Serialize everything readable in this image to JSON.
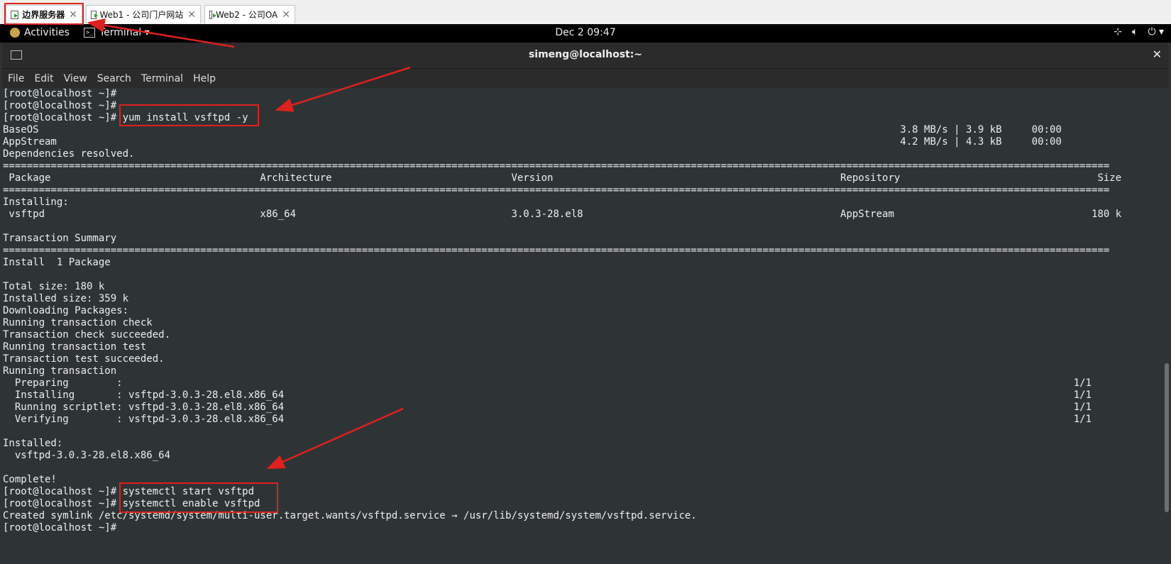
{
  "vm_tabs": [
    {
      "label": "边界服务器",
      "active": true
    },
    {
      "label": "Web1 - 公司门户网站",
      "active": false
    },
    {
      "label": "Web2 - 公司OA",
      "active": false
    }
  ],
  "topbar": {
    "activities": "Activities",
    "app": "Terminal ▾",
    "clock": "Dec 2  09:47",
    "icons": [
      "network-icon",
      "volume-icon",
      "power-icon"
    ]
  },
  "window": {
    "title": "simeng@localhost:~",
    "menu": [
      "File",
      "Edit",
      "View",
      "Search",
      "Terminal",
      "Help"
    ]
  },
  "terminal_lines": [
    "[root@localhost ~]#",
    "[root@localhost ~]#",
    "[root@localhost ~]# yum install vsftpd -y",
    "BaseOS                                                                                                                                                3.8 MB/s | 3.9 kB     00:00",
    "AppStream                                                                                                                                             4.2 MB/s | 4.3 kB     00:00",
    "Dependencies resolved.",
    "=========================================================================================================================================================================================",
    " Package                                   Architecture                              Version                                                Repository                                 Size",
    "=========================================================================================================================================================================================",
    "Installing:",
    " vsftpd                                    x86_64                                    3.0.3-28.el8                                           AppStream                                 180 k",
    "",
    "Transaction Summary",
    "=========================================================================================================================================================================================",
    "Install  1 Package",
    "",
    "Total size: 180 k",
    "Installed size: 359 k",
    "Downloading Packages:",
    "Running transaction check",
    "Transaction check succeeded.",
    "Running transaction test",
    "Transaction test succeeded.",
    "Running transaction",
    "  Preparing        :                                                                                                                                                               1/1",
    "  Installing       : vsftpd-3.0.3-28.el8.x86_64                                                                                                                                    1/1",
    "  Running scriptlet: vsftpd-3.0.3-28.el8.x86_64                                                                                                                                    1/1",
    "  Verifying        : vsftpd-3.0.3-28.el8.x86_64                                                                                                                                    1/1",
    "",
    "Installed:",
    "  vsftpd-3.0.3-28.el8.x86_64",
    "",
    "Complete!",
    "[root@localhost ~]# systemctl start vsftpd",
    "[root@localhost ~]# systemctl enable vsftpd",
    "Created symlink /etc/systemd/system/multi-user.target.wants/vsftpd.service → /usr/lib/systemd/system/vsftpd.service.",
    "[root@localhost ~]#"
  ],
  "colors": {
    "annotation": "#e0201c",
    "terminal_bg": "#2e3436",
    "terminal_fg": "#eeeeec"
  }
}
